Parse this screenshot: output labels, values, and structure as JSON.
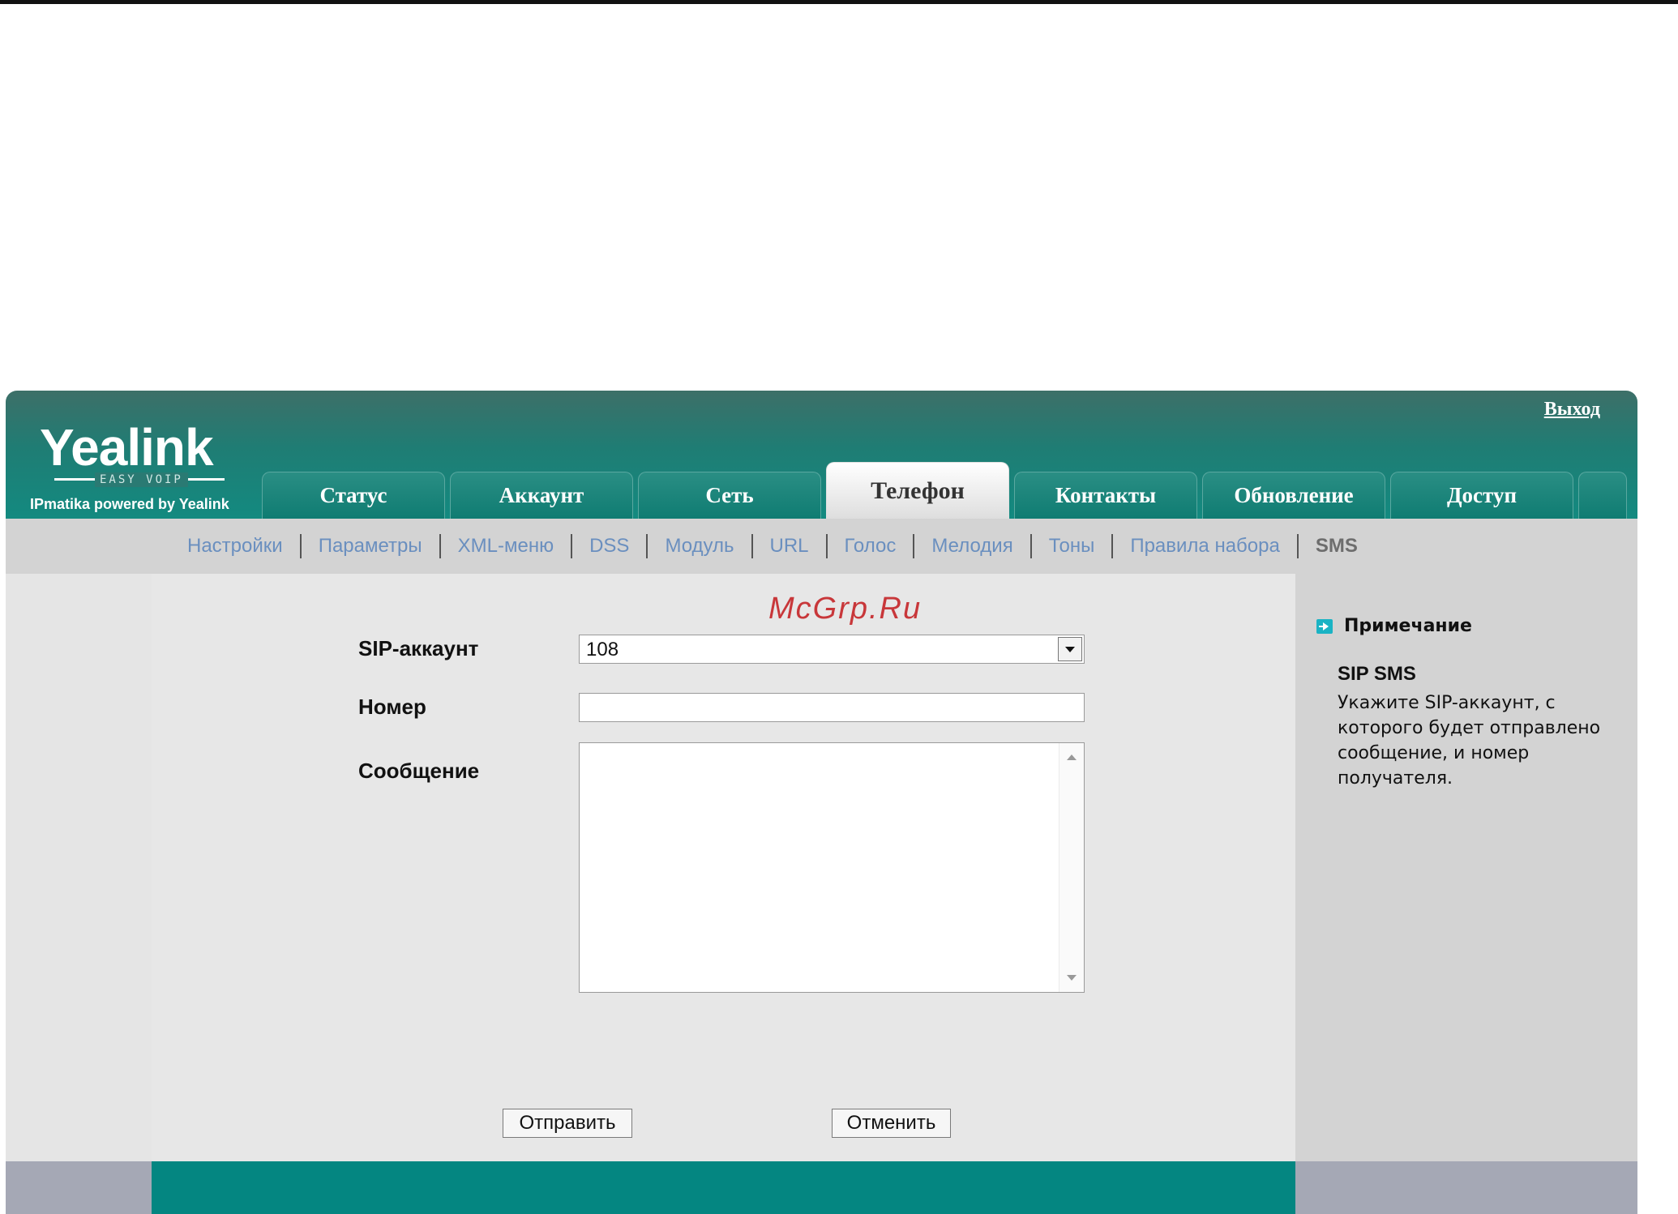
{
  "logo": {
    "brand": "Yealink",
    "tagline_small": "EASY VOIP",
    "powered": "IPmatika powered by Yealink"
  },
  "header": {
    "logout": "Выход"
  },
  "tabs": [
    {
      "label": "Статус"
    },
    {
      "label": "Аккаунт"
    },
    {
      "label": "Сеть"
    },
    {
      "label": "Телефон",
      "active": true
    },
    {
      "label": "Контакты"
    },
    {
      "label": "Обновление"
    },
    {
      "label": "Доступ"
    }
  ],
  "subnav": [
    {
      "label": "Настройки"
    },
    {
      "label": "Параметры"
    },
    {
      "label": "XML-меню"
    },
    {
      "label": "DSS"
    },
    {
      "label": "Модуль"
    },
    {
      "label": "URL"
    },
    {
      "label": "Голос"
    },
    {
      "label": "Мелодия"
    },
    {
      "label": "Тоны"
    },
    {
      "label": "Правила набора"
    },
    {
      "label": "SMS",
      "current": true
    }
  ],
  "watermark": "McGrp.Ru",
  "form": {
    "sip_account_label": "SIP-аккаунт",
    "sip_account_value": "108",
    "number_label": "Номер",
    "number_value": "",
    "message_label": "Сообщение",
    "message_value": "",
    "send_button": "Отправить",
    "cancel_button": "Отменить"
  },
  "note": {
    "title": "Примечание",
    "subtitle": "SIP SMS",
    "text": "Укажите SIP-аккаунт, с которого будет отправлено сообщение, и номер получателя."
  },
  "colors": {
    "header_teal": "#138a80",
    "footer_teal": "#048681",
    "link_blue": "#6a8fbf",
    "watermark_red": "#c8373a"
  }
}
